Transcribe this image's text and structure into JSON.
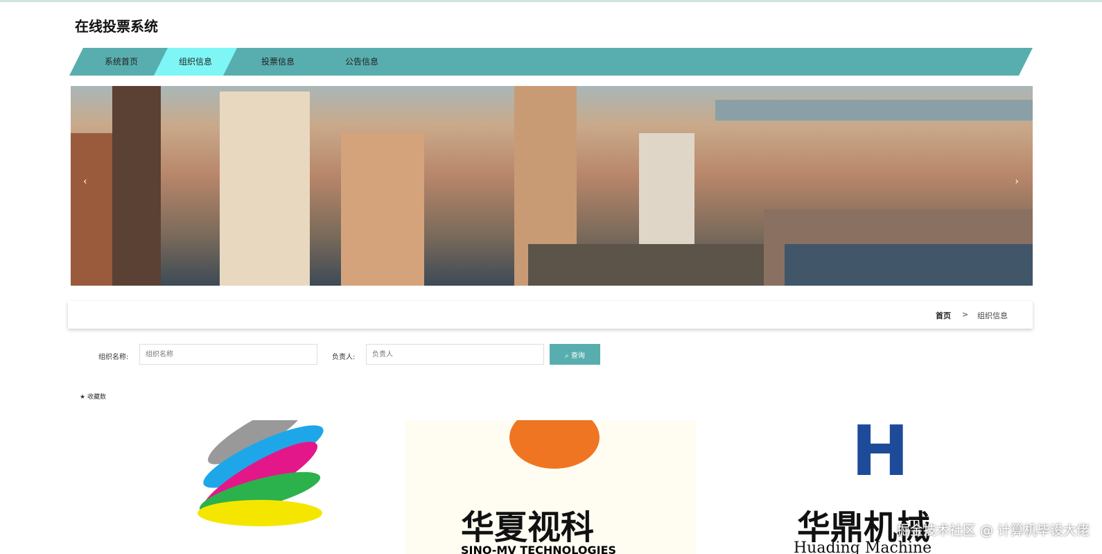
{
  "header": {
    "title": "在线投票系统"
  },
  "nav": {
    "items": [
      {
        "label": "系统首页"
      },
      {
        "label": "组织信息"
      },
      {
        "label": "投票信息"
      },
      {
        "label": "公告信息"
      }
    ],
    "active": 1
  },
  "breadcrumb": {
    "home": "首页",
    "sep": ">",
    "current": "组织信息"
  },
  "search": {
    "name_label": "组织名称:",
    "name_placeholder": "组织名称",
    "person_label": "负责人:",
    "person_placeholder": "负责人",
    "button": "查询"
  },
  "sort": {
    "label": "收藏数"
  },
  "cards": [
    {
      "name": "",
      "sub": ""
    },
    {
      "name": "华夏视科",
      "sub": "SINO-MV TECHNOLOGIES"
    },
    {
      "name": "华鼎机械",
      "sub": "Huading Machine"
    }
  ],
  "watermark": "掘金技术社区 @ 计算机毕设大佬",
  "colors": {
    "accent": "#58aeae",
    "active": "#7ef6f6"
  }
}
